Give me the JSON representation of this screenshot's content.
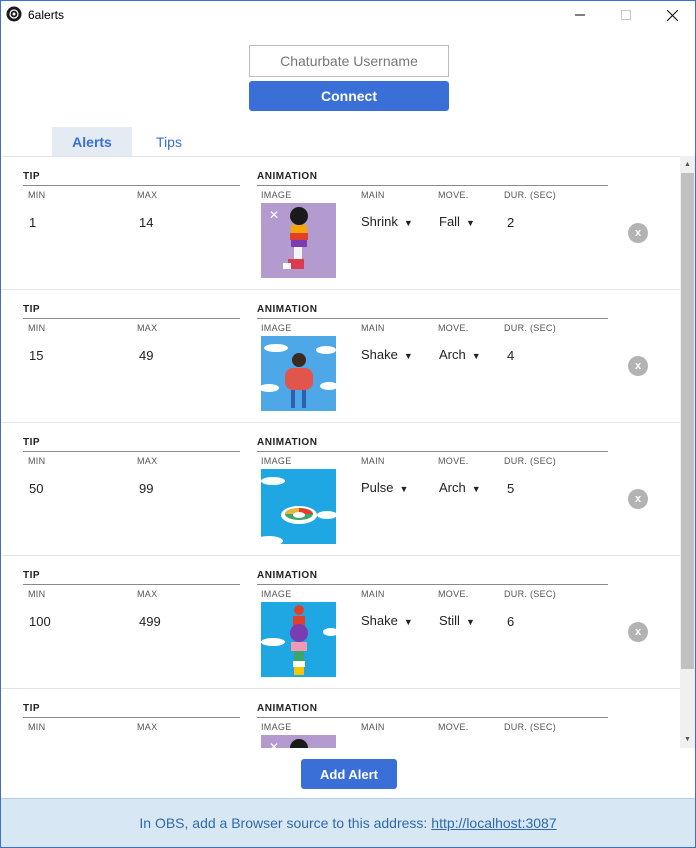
{
  "window": {
    "title": "6alerts"
  },
  "connect": {
    "username_placeholder": "Chaturbate Username",
    "username_value": "",
    "button_label": "Connect"
  },
  "tabs": [
    {
      "label": "Alerts",
      "active": true
    },
    {
      "label": "Tips",
      "active": false
    }
  ],
  "columns": {
    "tip": "TIP",
    "animation": "ANIMATION",
    "min": "MIN",
    "max": "MAX",
    "image": "IMAGE",
    "main": "MAIN",
    "move": "MOVE.",
    "dur": "DUR. (SEC)"
  },
  "alerts": [
    {
      "min": "1",
      "max": "14",
      "main": "Shrink",
      "move": "Fall",
      "dur": "2",
      "image": "purple-character-falling",
      "remove": "x"
    },
    {
      "min": "15",
      "max": "49",
      "main": "Shake",
      "move": "Arch",
      "dur": "4",
      "image": "bearded-man-clouds",
      "remove": "x"
    },
    {
      "min": "50",
      "max": "99",
      "main": "Pulse",
      "move": "Arch",
      "dur": "5",
      "image": "floating-ring-clouds",
      "remove": "x"
    },
    {
      "min": "100",
      "max": "499",
      "main": "Shake",
      "move": "Still",
      "dur": "6",
      "image": "stacked-characters-sky",
      "remove": "x"
    },
    {
      "min": "",
      "max": "",
      "main": "",
      "move": "",
      "dur": "",
      "image": "purple-character-falling",
      "remove": ""
    }
  ],
  "actions": {
    "add_alert": "Add Alert"
  },
  "footer": {
    "text": "In OBS, add a Browser source to this address:",
    "link": "http://localhost:3087"
  },
  "colors": {
    "accent": "#3a6fd8",
    "footer_bg": "#d7e8f4",
    "tab_active_bg": "#e4ebf2"
  }
}
